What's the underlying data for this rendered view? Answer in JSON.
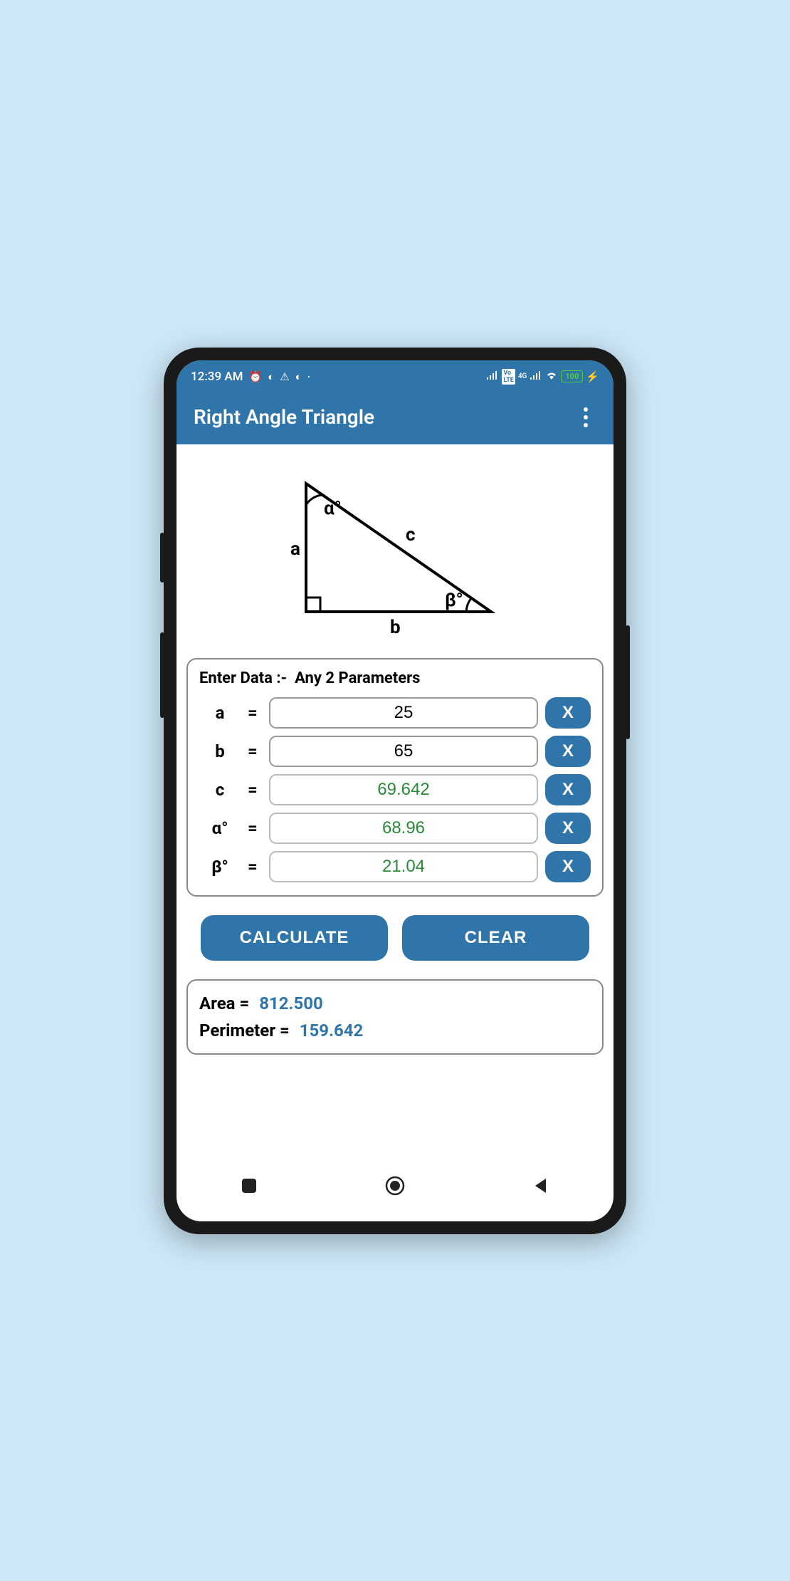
{
  "status_bar": {
    "time": "12:39 AM",
    "battery": "100"
  },
  "app_bar": {
    "title": "Right Angle Triangle"
  },
  "diagram": {
    "side_a": "a",
    "side_b": "b",
    "side_c": "c",
    "angle_alpha": "α°",
    "angle_beta": "β°"
  },
  "input_panel": {
    "header_prefix": "Enter Data :-",
    "header_suffix": "Any 2 Parameters",
    "rows": [
      {
        "label": "a",
        "value": "25",
        "calculated": false
      },
      {
        "label": "b",
        "value": "65",
        "calculated": false
      },
      {
        "label": "c",
        "value": "69.642",
        "calculated": true
      },
      {
        "label": "α°",
        "value": "68.96",
        "calculated": true
      },
      {
        "label": "β°",
        "value": "21.04",
        "calculated": true
      }
    ],
    "clear_x": "X",
    "equals": "="
  },
  "buttons": {
    "calculate": "CALCULATE",
    "clear": "CLEAR"
  },
  "results": {
    "area_label": "Area =",
    "area_value": "812.500",
    "perimeter_label": "Perimeter =",
    "perimeter_value": "159.642"
  }
}
